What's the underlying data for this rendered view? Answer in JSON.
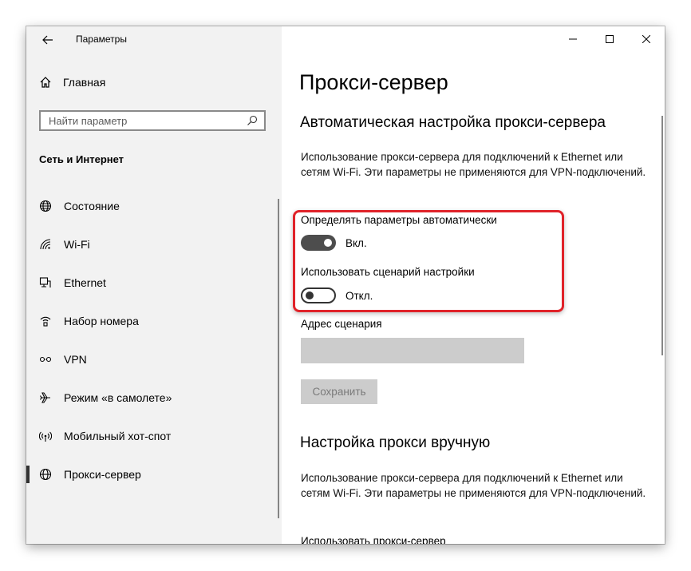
{
  "window": {
    "app_title": "Параметры",
    "controls": [
      "minimize-icon",
      "maximize-icon",
      "close-icon"
    ]
  },
  "sidebar": {
    "home_label": "Главная",
    "search_placeholder": "Найти параметр",
    "section_title": "Сеть и Интернет",
    "items": [
      {
        "label": "Состояние",
        "icon": "globe-status-icon"
      },
      {
        "label": "Wi-Fi",
        "icon": "wifi-icon"
      },
      {
        "label": "Ethernet",
        "icon": "ethernet-icon"
      },
      {
        "label": "Набор номера",
        "icon": "dialup-icon"
      },
      {
        "label": "VPN",
        "icon": "vpn-icon"
      },
      {
        "label": "Режим «в самолете»",
        "icon": "airplane-icon"
      },
      {
        "label": "Мобильный хот-спот",
        "icon": "hotspot-icon"
      },
      {
        "label": "Прокси-сервер",
        "icon": "globe-icon",
        "selected": true
      }
    ]
  },
  "main": {
    "page_title": "Прокси-сервер",
    "auto": {
      "heading": "Автоматическая настройка прокси-сервера",
      "description": "Использование прокси-сервера для подключений к Ethernet или сетям Wi-Fi. Эти параметры не применяются для VPN-подключений.",
      "detect_label": "Определять параметры автоматически",
      "detect_state": "Вкл.",
      "script_label": "Использовать сценарий настройки",
      "script_state": "Откл.",
      "address_label": "Адрес сценария",
      "address_value": "",
      "save_label": "Сохранить"
    },
    "manual": {
      "heading": "Настройка прокси вручную",
      "description": "Использование прокси-сервера для подключений к Ethernet или сетям Wi-Fi. Эти параметры не применяются для VPN-подключений.",
      "use_proxy_label": "Использовать прокси-сервер"
    }
  },
  "colors": {
    "accent_highlight": "#e0232a",
    "toggle_on": "#4d4d4d",
    "sidebar_bg": "#f2f2f2"
  }
}
